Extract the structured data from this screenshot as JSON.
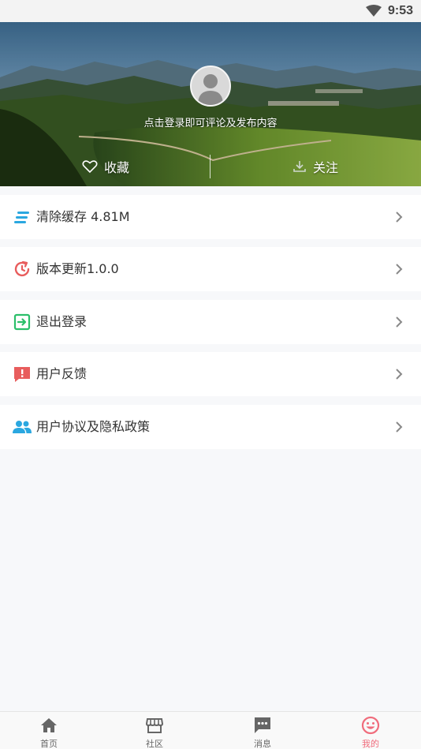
{
  "status_bar": {
    "time": "9:53"
  },
  "hero": {
    "login_hint": "点击登录即可评论及发布内容",
    "favorites_label": "收藏",
    "follow_label": "关注"
  },
  "menu": {
    "items": [
      {
        "label": "清除缓存 4.81M",
        "icon": "clear-cache-icon",
        "color": "#2aa7e0"
      },
      {
        "label": "版本更新1.0.0",
        "icon": "update-clock-icon",
        "color": "#e85d5d"
      },
      {
        "label": "退出登录",
        "icon": "logout-icon",
        "color": "#2bbf6a"
      },
      {
        "label": "用户反馈",
        "icon": "feedback-icon",
        "color": "#e85d5d"
      },
      {
        "label": "用户协议及隐私政策",
        "icon": "users-icon",
        "color": "#2aa7e0"
      }
    ]
  },
  "tabbar": {
    "tabs": [
      {
        "label": "首页",
        "icon": "home-icon"
      },
      {
        "label": "社区",
        "icon": "store-icon"
      },
      {
        "label": "消息",
        "icon": "message-icon"
      },
      {
        "label": "我的",
        "icon": "smile-icon",
        "active": true
      }
    ],
    "active_color": "#f06c7c"
  }
}
